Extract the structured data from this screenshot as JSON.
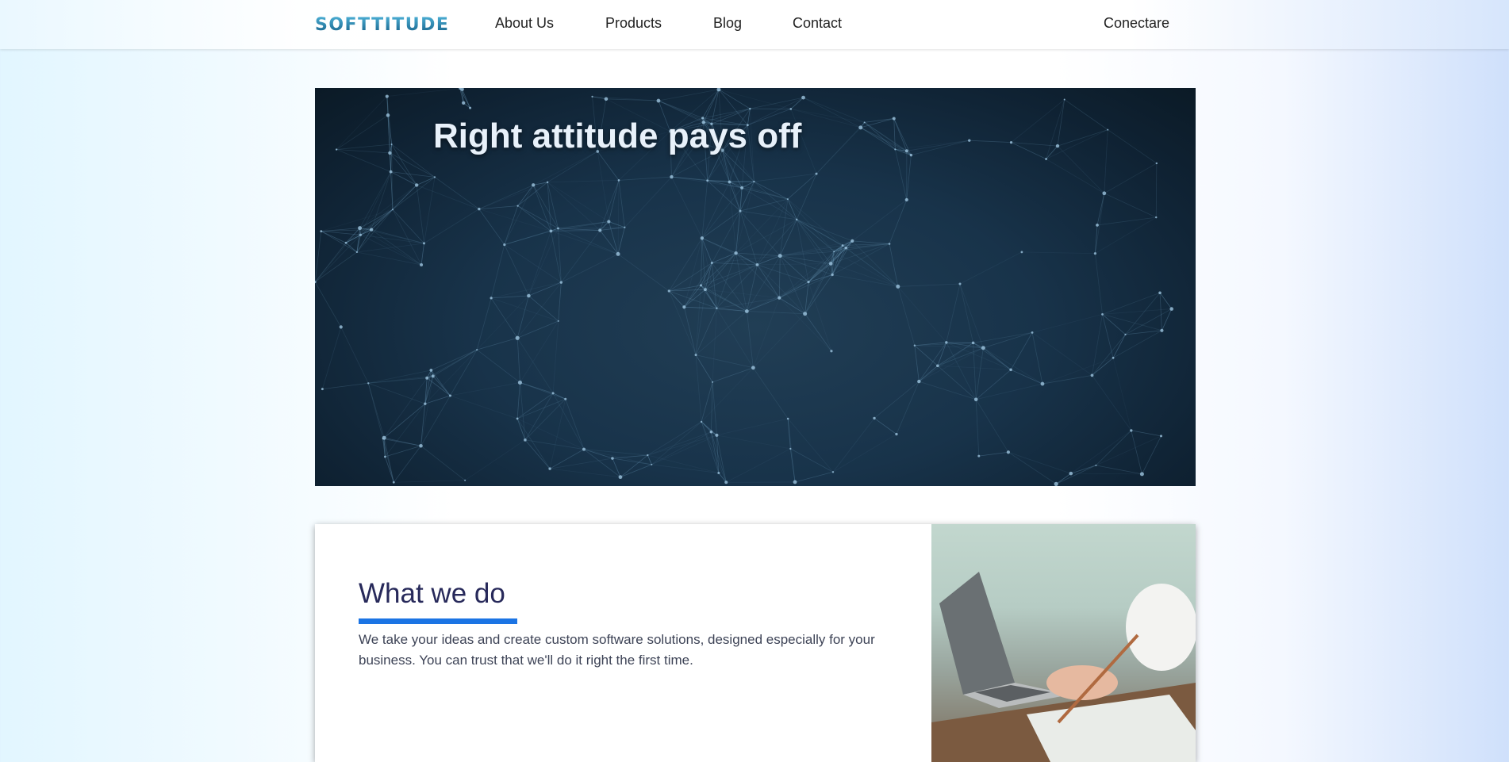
{
  "header": {
    "logo_text": "SOFTTITUDE",
    "nav": [
      {
        "label": "About Us"
      },
      {
        "label": "Products"
      },
      {
        "label": "Blog"
      },
      {
        "label": "Contact"
      }
    ],
    "login_label": "Conectare"
  },
  "hero": {
    "title": "Right attitude pays off"
  },
  "what_we_do": {
    "title": "What we do",
    "text": "We take your ideas and create custom software solutions, designed especially for your business. You can trust that we'll do it right the first time."
  },
  "colors": {
    "accent": "#1b74e4",
    "title": "#27295a",
    "logo": "#1b6f9a"
  },
  "icons": {
    "hero_background": "network-graph-image",
    "card_photo": "laptop-notes-photo"
  }
}
